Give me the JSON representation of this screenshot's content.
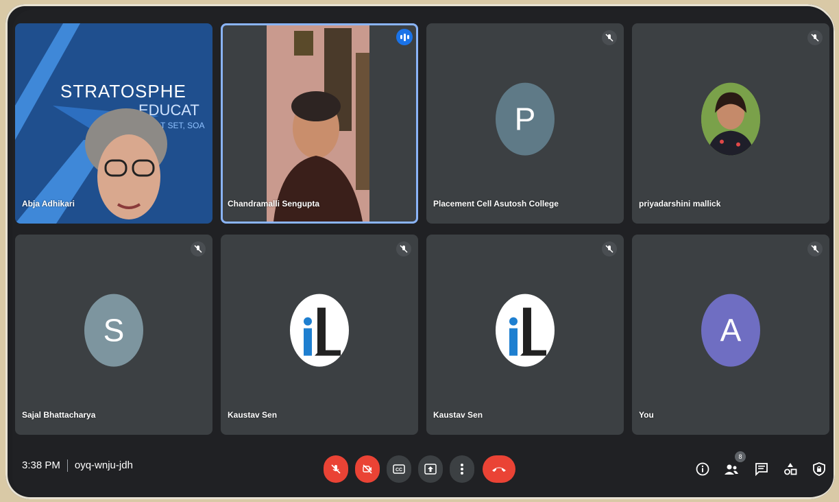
{
  "tiles": [
    {
      "name": "Abja Adhikari",
      "state": "presenting-video",
      "banner": {
        "line1": "STRATOSPHE",
        "line2": "EDUCAT",
        "line3": "T SET, SOA"
      }
    },
    {
      "name": "Chandramalli Sengupta",
      "state": "speaking"
    },
    {
      "name": "Placement Cell Asutosh College",
      "initial": "P",
      "avatar_color": "#5f7a87"
    },
    {
      "name": "priyadarshini mallick",
      "state": "photo"
    },
    {
      "name": "Sajal Bhattacharya",
      "initial": "S",
      "avatar_color": "#7d959f"
    },
    {
      "name": "Kaustav Sen",
      "logo": "iL"
    },
    {
      "name": "Kaustav Sen",
      "logo": "iL"
    },
    {
      "name": "You",
      "initial": "A",
      "avatar_color": "#6f6ec2"
    }
  ],
  "bottom": {
    "time": "3:38 PM",
    "meeting_code": "oyq-wnju-jdh",
    "participant_count": "8"
  },
  "colors": {
    "end_call": "#ea4335",
    "active_border": "#8ab4f8",
    "tile_bg": "#3c4043"
  }
}
